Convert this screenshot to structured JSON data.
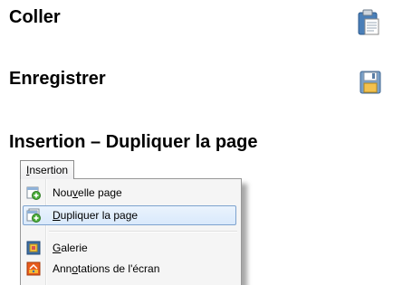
{
  "sections": {
    "paste": {
      "title": "Coller",
      "icon": "paste-icon"
    },
    "save": {
      "title": "Enregistrer",
      "icon": "save-icon"
    },
    "insert": {
      "title": "Insertion – Dupliquer la page"
    }
  },
  "menubar": {
    "label_prefix": "I",
    "label_rest": "nsertion"
  },
  "menu": {
    "items": [
      {
        "label_pre": "Nou",
        "label_ul": "v",
        "label_post": "elle page",
        "icon": "new-page-icon"
      },
      {
        "label_pre": "",
        "label_ul": "D",
        "label_post": "upliquer la page",
        "icon": "duplicate-page-icon",
        "highlighted": true
      },
      {
        "label_pre": "",
        "label_ul": "G",
        "label_post": "alerie",
        "icon": "gallery-icon"
      },
      {
        "label_pre": "Ann",
        "label_ul": "o",
        "label_post": "tations de l'écran",
        "icon": "screen-annotations-icon"
      }
    ]
  },
  "colors": {
    "highlight_border": "#7da2ce",
    "highlight_fill": "#d9e9fb",
    "menu_background": "#f5f5f5"
  }
}
